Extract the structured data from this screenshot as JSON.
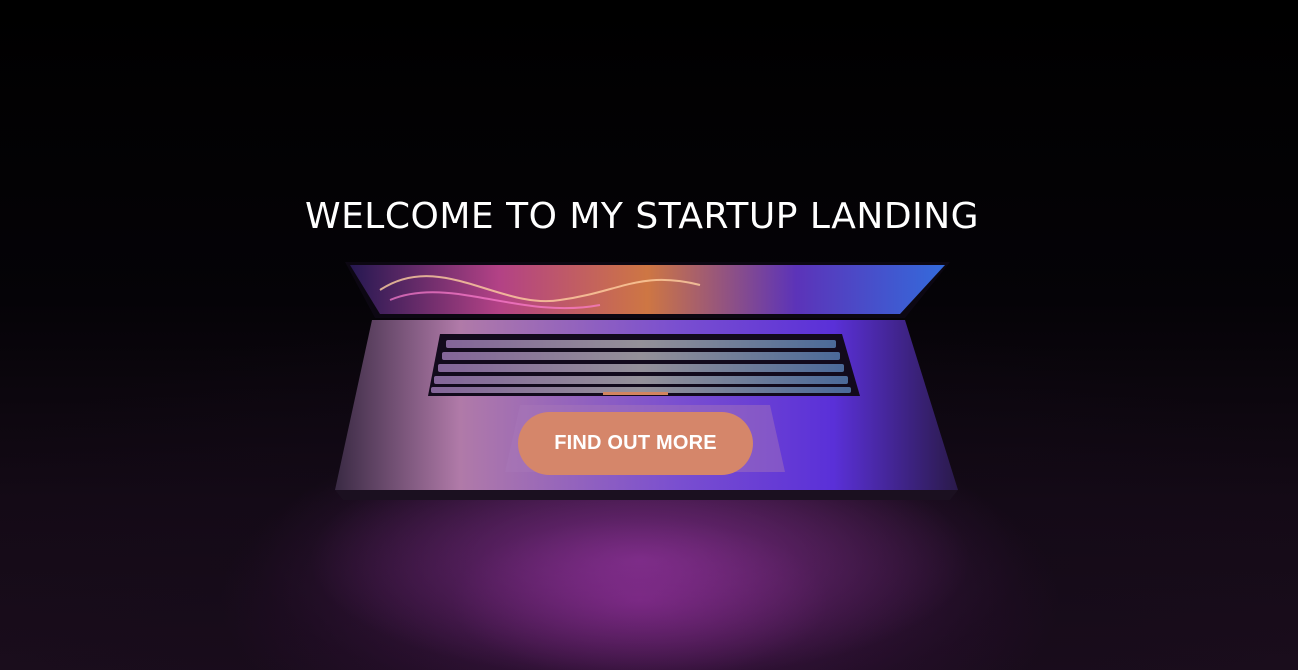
{
  "hero": {
    "headline": "WELCOME TO MY STARTUP LANDING",
    "cta_label": "FIND OUT MORE",
    "background_image": "laptop-glowing-keyboard-image"
  },
  "colors": {
    "accent": "#d2855f",
    "button": "#d5866a",
    "text": "#ffffff",
    "background": "#000000"
  }
}
